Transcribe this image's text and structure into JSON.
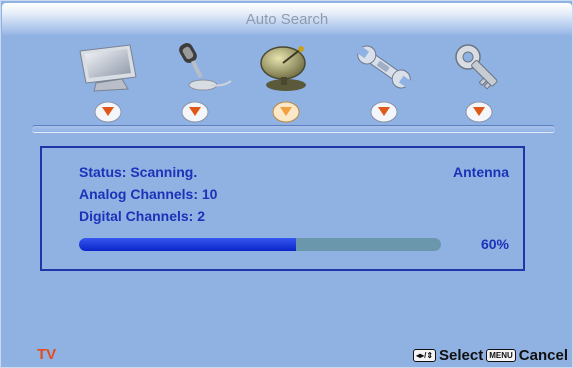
{
  "title": "Auto Search",
  "menu_icons": [
    {
      "name": "picture-icon"
    },
    {
      "name": "audio-icon"
    },
    {
      "name": "tv-antenna-icon"
    },
    {
      "name": "setup-wrench-icon"
    },
    {
      "name": "parental-lock-key-icon"
    }
  ],
  "selected_tab_index": 2,
  "colors": {
    "background": "#8fb2e3",
    "text_blue": "#1c32b8",
    "progress_fill": "#0a24c8",
    "progress_track": "#6b97ad",
    "source_label": "#e34c1e",
    "tab_marker_active": "#f0a040",
    "tab_marker_inactive": "#e05818"
  },
  "scan": {
    "status": "Status: Scanning.",
    "analog": "Analog Channels: 10",
    "digital": "Digital Channels: 2",
    "source": "Antenna",
    "progress_percent": 60,
    "progress_text": "60%"
  },
  "footer": {
    "source": "TV",
    "nav_key_icon": "arrows-key-icon",
    "select_label": "Select",
    "menu_key": "MENU",
    "cancel_label": "Cancel"
  }
}
